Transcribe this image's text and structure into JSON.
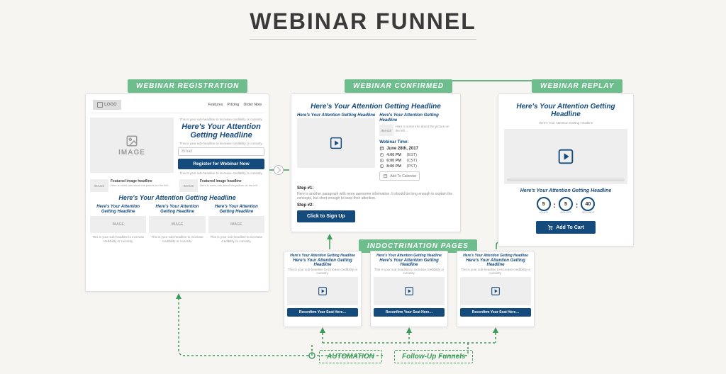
{
  "title": "WEBINAR FUNNEL",
  "tags": {
    "registration": "WEBINAR REGISTRATION",
    "confirmed": "WEBINAR CONFIRMED",
    "replay": "WEBINAR REPLAY",
    "indoctrination": "INDOCTRINATION PAGES"
  },
  "registration": {
    "logo": "LOGO",
    "nav": [
      "Features",
      "Pricing",
      "Order Now"
    ],
    "image_label": "IMAGE",
    "pre_headline": "This is your sub-headline to increase credibility or curiosity.",
    "headline": "Here's Your Attention Getting Headline",
    "sub_headline": "This is your sub-headline to increase credibility or curiosity.",
    "email_placeholder": "Email",
    "cta": "Register for Webinar Now",
    "post_cta": "This is your sub-headline to increase credibility or curiosity.",
    "features": [
      {
        "title": "Featured image headline",
        "body": "Here is some info about the picture on the left…",
        "img": "IMAGE"
      },
      {
        "title": "Featured image headline",
        "body": "Here is some info about the picture on the left…",
        "img": "IMAGE"
      }
    ],
    "section_headline": "Here's Your Attention Getting Headline",
    "columns": [
      {
        "headline": "Here's Your Attention Getting Headline",
        "img": "IMAGE",
        "sub": "This is your sub-headline to increase credibility or curiosity."
      },
      {
        "headline": "Here's Your Attention Getting Headline",
        "img": "IMAGE",
        "sub": "This is your sub-headline to increase credibility or curiosity."
      },
      {
        "headline": "Here's Your Attention Getting Headline",
        "img": "IMAGE",
        "sub": "This is your sub-headline to increase credibility or curiosity."
      }
    ]
  },
  "confirmed": {
    "headline": "Here's Your Attention Getting Headline",
    "sub_headline": "Here's Your Attention Getting Headline",
    "side_headline": "Here's Your Attention Getting Headline",
    "side_img": "IMAGE",
    "side_body": "Here is some info about the picture on the left…",
    "webtime_label": "Webinar Time:",
    "date": "June 28th, 2017",
    "times": [
      {
        "t": "4:00 PM",
        "tz": "(EST)"
      },
      {
        "t": "6:00 PM",
        "tz": "(CST)"
      },
      {
        "t": "8:00 PM",
        "tz": "(PST)"
      }
    ],
    "add_to_calendar": "Add To Calendar",
    "step1_title": "Step #1:",
    "step1_body": "Here is another paragraph with more awesome information. It should be long enough to explain the concepts, but short enough to keep their attention.",
    "step2_title": "Step #2:",
    "cta": "Click to Sign Up"
  },
  "replay": {
    "headline": "Here's Your Attention Getting Headline",
    "sub_headline": "Here's Your Attention Getting Headline",
    "countdown_headline": "Here's Your Attention Getting Headline",
    "countdown": {
      "hours": "5",
      "hours_label": "HOURS",
      "minutes": "5",
      "minutes_label": "MINUTES",
      "seconds": "40",
      "seconds_label": "SECONDS"
    },
    "cta": "Add To Cart"
  },
  "indoctrination": {
    "pages": [
      {
        "headline": "Here's Your Attention Getting Headline",
        "sub": "Here's Your Attention Getting Headline",
        "note": "This is your sub-headline to increase credibility or curiosity.",
        "cta": "Reconfirm Your Seat Here…"
      },
      {
        "headline": "Here's Your Attention Getting Headline",
        "sub": "Here's Your Attention Getting Headline",
        "note": "This is your sub-headline to increase credibility or curiosity.",
        "cta": "Reconfirm Your Seat Here…"
      },
      {
        "headline": "Here's Your Attention Getting Headline",
        "sub": "Here's Your Attention Getting Headline",
        "note": "This is your sub-headline to increase credibility or curiosity.",
        "cta": "Reconfirm Your Seat Here…"
      }
    ]
  },
  "bottom": {
    "automation": "AUTOMATION",
    "followup": "Follow-Up Funnels"
  }
}
